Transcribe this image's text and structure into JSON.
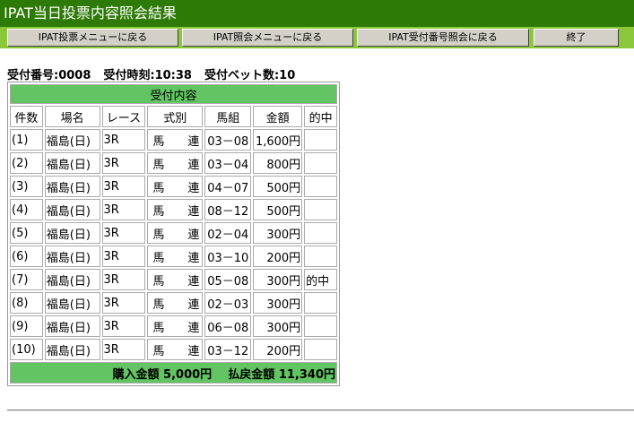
{
  "header": {
    "title": "IPAT当日投票内容照会結果"
  },
  "nav": {
    "back_vote_menu": "IPAT投票メニューに戻る",
    "back_inquiry_menu": "IPAT照会メニューに戻る",
    "back_receipt_inquiry": "IPAT受付番号照会に戻る",
    "end": "終了"
  },
  "summary": {
    "receipt_no": "受付番号:0008",
    "receipt_time": "受付時刻:10:38",
    "bet_count": "受付ベット数:10"
  },
  "table": {
    "caption": "受付内容",
    "headers": [
      "件数",
      "場名",
      "レース",
      "式別",
      "馬組",
      "金額",
      "的中"
    ],
    "rows": [
      {
        "num": "(1)",
        "place": "福島(日)",
        "race": "3R",
        "type": "馬連",
        "horses": "03－08",
        "amount": "1,600円",
        "hit": ""
      },
      {
        "num": "(2)",
        "place": "福島(日)",
        "race": "3R",
        "type": "馬連",
        "horses": "03－04",
        "amount": "800円",
        "hit": ""
      },
      {
        "num": "(3)",
        "place": "福島(日)",
        "race": "3R",
        "type": "馬連",
        "horses": "04－07",
        "amount": "500円",
        "hit": ""
      },
      {
        "num": "(4)",
        "place": "福島(日)",
        "race": "3R",
        "type": "馬連",
        "horses": "08－12",
        "amount": "500円",
        "hit": ""
      },
      {
        "num": "(5)",
        "place": "福島(日)",
        "race": "3R",
        "type": "馬連",
        "horses": "02－04",
        "amount": "300円",
        "hit": ""
      },
      {
        "num": "(6)",
        "place": "福島(日)",
        "race": "3R",
        "type": "馬連",
        "horses": "03－10",
        "amount": "200円",
        "hit": ""
      },
      {
        "num": "(7)",
        "place": "福島(日)",
        "race": "3R",
        "type": "馬連",
        "horses": "05－08",
        "amount": "300円",
        "hit": "的中"
      },
      {
        "num": "(8)",
        "place": "福島(日)",
        "race": "3R",
        "type": "馬連",
        "horses": "02－03",
        "amount": "300円",
        "hit": ""
      },
      {
        "num": "(9)",
        "place": "福島(日)",
        "race": "3R",
        "type": "馬連",
        "horses": "06－08",
        "amount": "300円",
        "hit": ""
      },
      {
        "num": "(10)",
        "place": "福島(日)",
        "race": "3R",
        "type": "馬連",
        "horses": "03－12",
        "amount": "200円",
        "hit": ""
      }
    ],
    "footer": {
      "purchase_label": "購入金額",
      "purchase_amount": "5,000円",
      "refund_label": "払戻金額",
      "refund_amount": "11,340円"
    }
  }
}
